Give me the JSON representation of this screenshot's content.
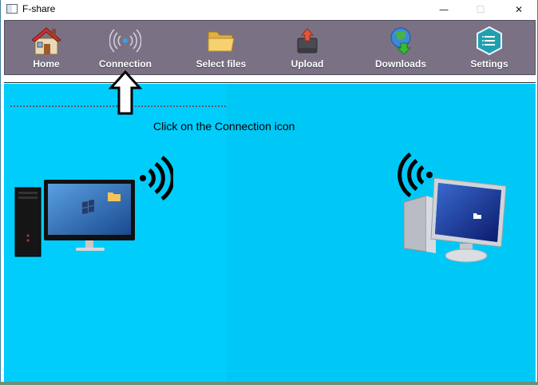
{
  "window": {
    "title": "F-share"
  },
  "titlebar_controls": {
    "minimize": "—",
    "maximize": "☐",
    "close": "✕"
  },
  "toolbar": {
    "items": [
      {
        "label": "Home",
        "icon": "house-icon"
      },
      {
        "label": "Connection",
        "icon": "wireless-signal-icon"
      },
      {
        "label": "Select files",
        "icon": "folder-icon"
      },
      {
        "label": "Upload",
        "icon": "upload-icon"
      },
      {
        "label": "Downloads",
        "icon": "globe-download-icon"
      },
      {
        "label": "Settings",
        "icon": "hexagon-menu-icon"
      }
    ]
  },
  "content": {
    "instruction": "Click on the Connection icon"
  },
  "colors": {
    "toolbar_bg": "#7b7185",
    "pane_left": "#00cdfb",
    "pane_right": "#00c8f6"
  }
}
